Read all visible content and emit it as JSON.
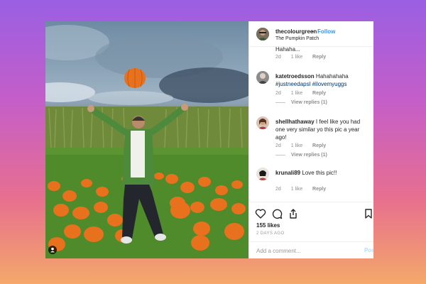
{
  "post": {
    "username": "thecolourgreen",
    "follow_label": "Follow",
    "separator": "•",
    "location": "The Pumpkin Patch"
  },
  "comments": [
    {
      "username": "",
      "text": "Hahaha...",
      "time": "2d",
      "likes": "1 like",
      "reply": "Reply"
    },
    {
      "username": "katetroedsson",
      "text": "Hahahahaha",
      "hashtags": "#justneedapsl #ilovemyuggs",
      "time": "2d",
      "likes": "1 like",
      "reply": "Reply",
      "view_replies": "View replies (1)"
    },
    {
      "username": "shellhathaway",
      "text": "I feel like you had one very similar yo this pic a year ago!",
      "time": "2d",
      "likes": "1 like",
      "reply": "Reply",
      "view_replies": "View replies (1)"
    },
    {
      "username": "krunali89",
      "text": "Love this pic!!",
      "time": "2d",
      "likes": "1 like",
      "reply": "Reply"
    }
  ],
  "actions": {
    "icons": [
      "heart-icon",
      "comment-icon",
      "share-icon",
      "bookmark-icon"
    ],
    "likes": "155 likes",
    "posted": "2 DAYS AGO"
  },
  "add_comment": {
    "placeholder": "Add a comment...",
    "post_label": "Post"
  },
  "colors": {
    "link_blue": "#3897f0",
    "hashtag": "#003569",
    "post_disabled": "#b2dffc",
    "pumpkin": "#e8711e"
  }
}
